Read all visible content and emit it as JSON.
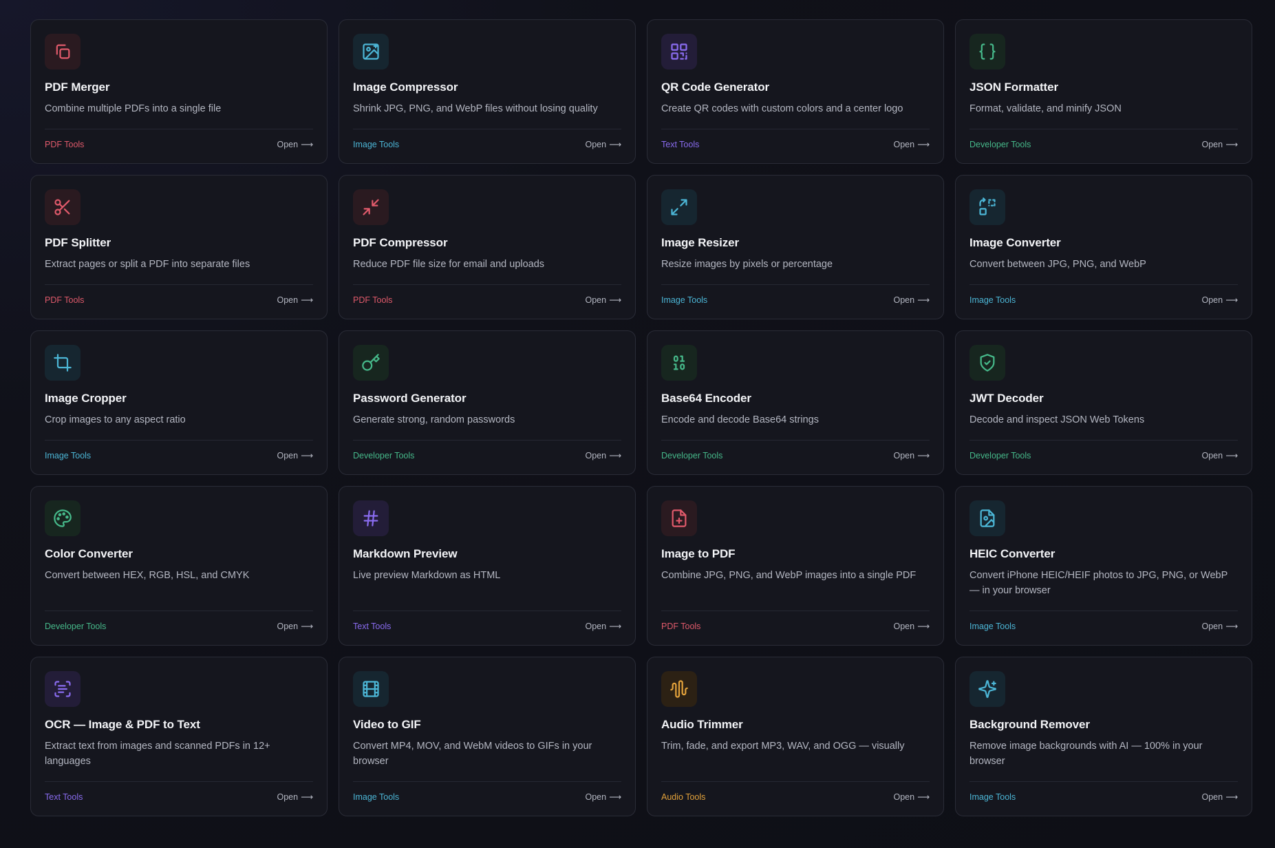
{
  "open_label": "Open",
  "open_arrow": "⟶",
  "colors": {
    "pdf": "#e05a6b",
    "image": "#4cb6d6",
    "text": "#8a6cf0",
    "developer": "#46b98a",
    "audio": "#e3a23b"
  },
  "tools": [
    {
      "title": "PDF Merger",
      "desc": "Combine multiple PDFs into a single file",
      "category": "PDF Tools",
      "icon": "copy-icon"
    },
    {
      "title": "Image Compressor",
      "desc": "Shrink JPG, PNG, and WebP files without losing quality",
      "category": "Image Tools",
      "icon": "image-sparkle-icon"
    },
    {
      "title": "QR Code Generator",
      "desc": "Create QR codes with custom colors and a center logo",
      "category": "Text Tools",
      "icon": "qr-code-icon"
    },
    {
      "title": "JSON Formatter",
      "desc": "Format, validate, and minify JSON",
      "category": "Developer Tools",
      "icon": "braces-icon"
    },
    {
      "title": "PDF Splitter",
      "desc": "Extract pages or split a PDF into separate files",
      "category": "PDF Tools",
      "icon": "scissors-icon"
    },
    {
      "title": "PDF Compressor",
      "desc": "Reduce PDF file size for email and uploads",
      "category": "PDF Tools",
      "icon": "minimize-icon"
    },
    {
      "title": "Image Resizer",
      "desc": "Resize images by pixels or percentage",
      "category": "Image Tools",
      "icon": "maximize-icon"
    },
    {
      "title": "Image Converter",
      "desc": "Convert between JPG, PNG, and WebP",
      "category": "Image Tools",
      "icon": "convert-icon"
    },
    {
      "title": "Image Cropper",
      "desc": "Crop images to any aspect ratio",
      "category": "Image Tools",
      "icon": "crop-icon"
    },
    {
      "title": "Password Generator",
      "desc": "Generate strong, random passwords",
      "category": "Developer Tools",
      "icon": "key-icon"
    },
    {
      "title": "Base64 Encoder",
      "desc": "Encode and decode Base64 strings",
      "category": "Developer Tools",
      "icon": "binary-icon"
    },
    {
      "title": "JWT Decoder",
      "desc": "Decode and inspect JSON Web Tokens",
      "category": "Developer Tools",
      "icon": "shield-check-icon"
    },
    {
      "title": "Color Converter",
      "desc": "Convert between HEX, RGB, HSL, and CMYK",
      "category": "Developer Tools",
      "icon": "palette-icon"
    },
    {
      "title": "Markdown Preview",
      "desc": "Live preview Markdown as HTML",
      "category": "Text Tools",
      "icon": "hash-icon"
    },
    {
      "title": "Image to PDF",
      "desc": "Combine JPG, PNG, and WebP images into a single PDF",
      "category": "PDF Tools",
      "icon": "file-plus-icon"
    },
    {
      "title": "HEIC Converter",
      "desc": "Convert iPhone HEIC/HEIF photos to JPG, PNG, or WebP — in your browser",
      "category": "Image Tools",
      "icon": "file-image-icon"
    },
    {
      "title": "OCR — Image & PDF to Text",
      "desc": "Extract text from images and scanned PDFs in 12+ languages",
      "category": "Text Tools",
      "icon": "scan-text-icon"
    },
    {
      "title": "Video to GIF",
      "desc": "Convert MP4, MOV, and WebM videos to GIFs in your browser",
      "category": "Image Tools",
      "icon": "film-icon"
    },
    {
      "title": "Audio Trimmer",
      "desc": "Trim, fade, and export MP3, WAV, and OGG — visually",
      "category": "Audio Tools",
      "icon": "audio-wave-icon"
    },
    {
      "title": "Background Remover",
      "desc": "Remove image backgrounds with AI — 100% in your browser",
      "category": "Image Tools",
      "icon": "sparkles-icon"
    }
  ]
}
